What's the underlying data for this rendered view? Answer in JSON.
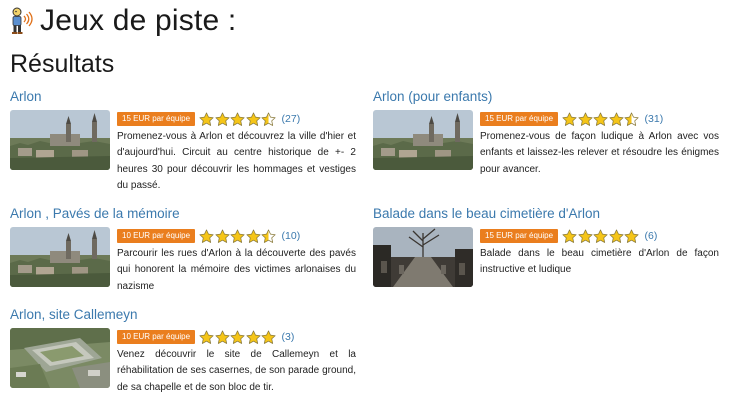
{
  "page": {
    "title": "Jeux de piste :",
    "results_heading": "Résultats"
  },
  "colors": {
    "accent": "#3b79ad",
    "badge": "#ea7e1e",
    "star": "#f5c518"
  },
  "results": [
    {
      "title": "Arlon",
      "price": "15 EUR par équipe",
      "rating": 4.5,
      "rating_count": "(27)",
      "description": "Promenez-vous à Arlon et découvrez la ville d'hier et d'aujourd'hui. Circuit au centre historique de +- 2 heures 30 pour découvrir les hommages et vestiges du passé.",
      "thumbnail": "arlon-skyline-photo"
    },
    {
      "title": "Arlon (pour enfants)",
      "price": "15 EUR par équipe",
      "rating": 4.5,
      "rating_count": "(31)",
      "description": "Promenez-vous de façon ludique à Arlon avec vos enfants et laissez-les relever et résoudre les énigmes pour avancer.",
      "thumbnail": "arlon-skyline-photo"
    },
    {
      "title": "Arlon , Pavés de la mémoire",
      "price": "10 EUR par équipe",
      "rating": 4.5,
      "rating_count": "(10)",
      "description": "Parcourir les rues d'Arlon à la découverte des pavés qui honorent la mémoire des victimes arlonaises du nazisme",
      "thumbnail": "arlon-skyline-photo"
    },
    {
      "title": "Balade dans le beau cimetière d'Arlon",
      "price": "15 EUR par équipe",
      "rating": 5,
      "rating_count": "(6)",
      "description": "Balade dans le beau cimetière d'Arlon de façon instructive et ludique",
      "thumbnail": "cemetery-photo"
    },
    {
      "title": "Arlon, site Callemeyn",
      "price": "10 EUR par équipe",
      "rating": 5,
      "rating_count": "(3)",
      "description": "Venez découvrir le site de Callemeyn et la réhabilitation de ses casernes, de son parade ground, de sa chapelle et de son bloc de tir.",
      "thumbnail": "aerial-barracks-photo"
    }
  ]
}
